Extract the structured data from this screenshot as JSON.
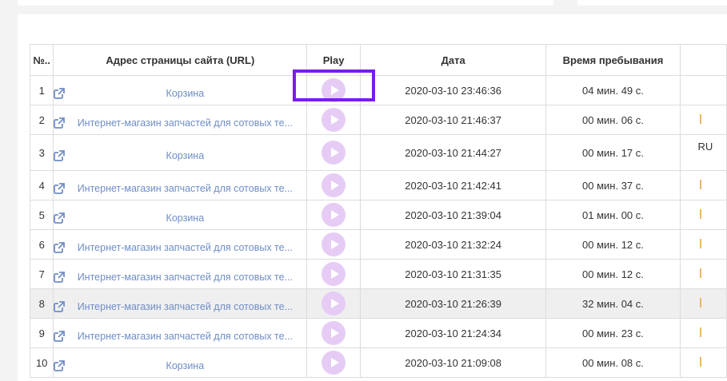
{
  "table": {
    "headers": {
      "num": "№..",
      "url": "Адрес страницы сайта (URL)",
      "play": "Play",
      "date": "Дата",
      "duration": "Время пребывания"
    },
    "rows": [
      {
        "num": "1",
        "url": "Корзина",
        "date": "2020-03-10 23:46:36",
        "duration": "04 мин. 49 с.",
        "extra": ""
      },
      {
        "num": "2",
        "url": "Интернет-магазин запчастей для сотовых те...",
        "date": "2020-03-10 21:46:37",
        "duration": "00 мин. 06 с.",
        "extra": ""
      },
      {
        "num": "3",
        "url": "Корзина",
        "date": "2020-03-10 21:44:27",
        "duration": "00 мин. 17 с.",
        "extra": "RU"
      },
      {
        "num": "4",
        "url": "Интернет-магазин запчастей для сотовых те...",
        "date": "2020-03-10 21:42:41",
        "duration": "00 мин. 37 с.",
        "extra": ""
      },
      {
        "num": "5",
        "url": "Корзина",
        "date": "2020-03-10 21:39:04",
        "duration": "01 мин. 00 с.",
        "extra": ""
      },
      {
        "num": "6",
        "url": "Интернет-магазин запчастей для сотовых те...",
        "date": "2020-03-10 21:32:24",
        "duration": "00 мин. 12 с.",
        "extra": ""
      },
      {
        "num": "7",
        "url": "Интернет-магазин запчастей для сотовых те...",
        "date": "2020-03-10 21:31:35",
        "duration": "00 мин. 12 с.",
        "extra": ""
      },
      {
        "num": "8",
        "url": "Интернет-магазин запчастей для сотовых те...",
        "date": "2020-03-10 21:26:39",
        "duration": "32 мин. 04 с.",
        "extra": ""
      },
      {
        "num": "9",
        "url": "Интернет-магазин запчастей для сотовых те...",
        "date": "2020-03-10 21:24:34",
        "duration": "00 мин. 23 с.",
        "extra": ""
      },
      {
        "num": "10",
        "url": "Корзина",
        "date": "2020-03-10 21:09:08",
        "duration": "00 мин. 08 с.",
        "extra": ""
      }
    ],
    "highlighted_row": "8"
  },
  "icons": {
    "url_icon": "external-link-icon",
    "play_icon": "play-icon"
  },
  "colors": {
    "link": "#6f8dc6",
    "play_button_bg": "#e6ccf5",
    "play_triangle": "#ffffff",
    "annotation_box": "#7a1cf0",
    "row_highlight": "#efefef",
    "extra_marker": "#e8b76a"
  }
}
